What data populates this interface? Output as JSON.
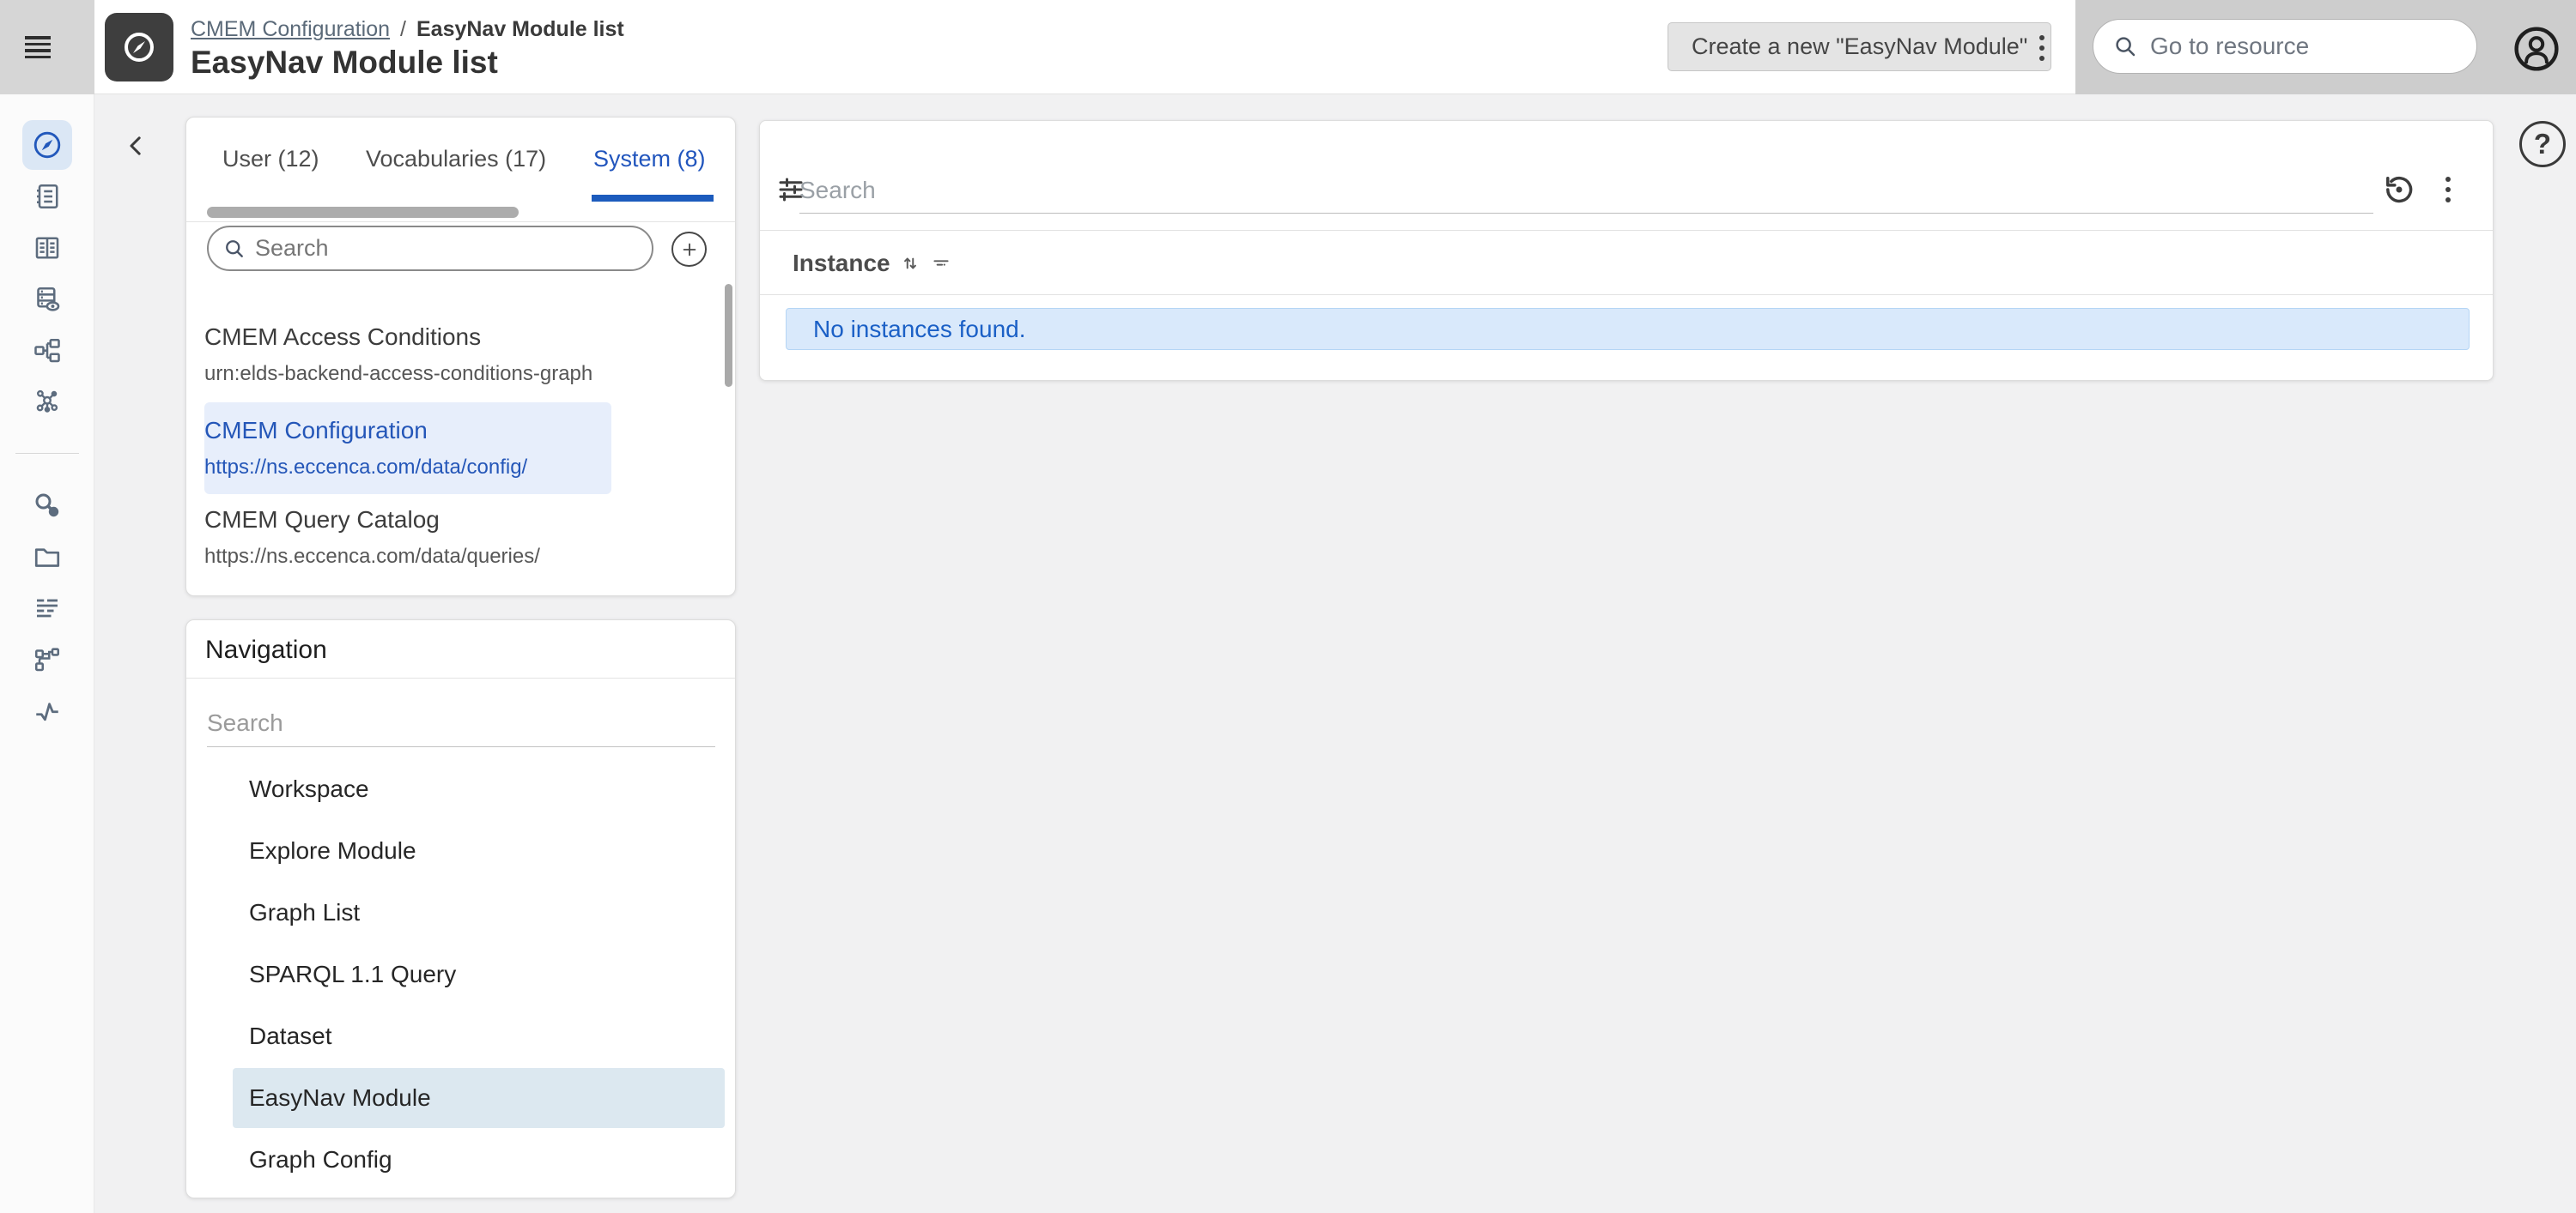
{
  "topbar": {
    "breadcrumb": {
      "parent": "CMEM Configuration",
      "separator": "/",
      "current": "EasyNav Module list"
    },
    "page_title": "EasyNav Module list",
    "create_button_label": "Create a new \"EasyNav Module\"",
    "resource_search_placeholder": "Go to resource"
  },
  "sidebar": {
    "icons": [
      {
        "name": "explore-compass-icon",
        "selected": true
      },
      {
        "name": "journal-icon"
      },
      {
        "name": "book-open-icon"
      },
      {
        "name": "dataset-preview-icon"
      },
      {
        "name": "class-hierarchy-icon"
      },
      {
        "name": "graph-network-icon"
      },
      {
        "name": "resource-link-icon"
      },
      {
        "name": "folder-icon"
      },
      {
        "name": "text-lines-icon"
      },
      {
        "name": "workflow-icon"
      },
      {
        "name": "activity-icon"
      }
    ]
  },
  "tabs_panel": {
    "tabs": [
      {
        "label": "User (12)"
      },
      {
        "label": "Vocabularies (17)"
      },
      {
        "label": "System (8)"
      }
    ],
    "active_tab": "System (8)",
    "search_placeholder": "Search",
    "graphs": [
      {
        "title": "CMEM Access Conditions",
        "uri": "urn:elds-backend-access-conditions-graph",
        "selected": false
      },
      {
        "title": "CMEM Configuration",
        "uri": "https://ns.eccenca.com/data/config/",
        "selected": true
      },
      {
        "title": "CMEM Query Catalog",
        "uri": "https://ns.eccenca.com/data/queries/",
        "selected": false
      }
    ]
  },
  "navigation_panel": {
    "title": "Navigation",
    "search_placeholder": "Search",
    "items": [
      "Workspace",
      "Explore Module",
      "Graph List",
      "SPARQL 1.1 Query",
      "Dataset",
      "EasyNav Module",
      "Graph Config"
    ],
    "selected_item": "EasyNav Module"
  },
  "main": {
    "search_placeholder": "Search",
    "column_header": "Instance",
    "empty_message": "No instances found.",
    "help_label": "?"
  },
  "colors": {
    "accent_blue": "#1c5bbd",
    "link_blue": "#2155bd",
    "selection_blue_bg": "#e7eefb",
    "nav_selection_bg": "#dce8f0",
    "info_bg": "#d9e9fb",
    "info_text": "#1b60c6"
  }
}
